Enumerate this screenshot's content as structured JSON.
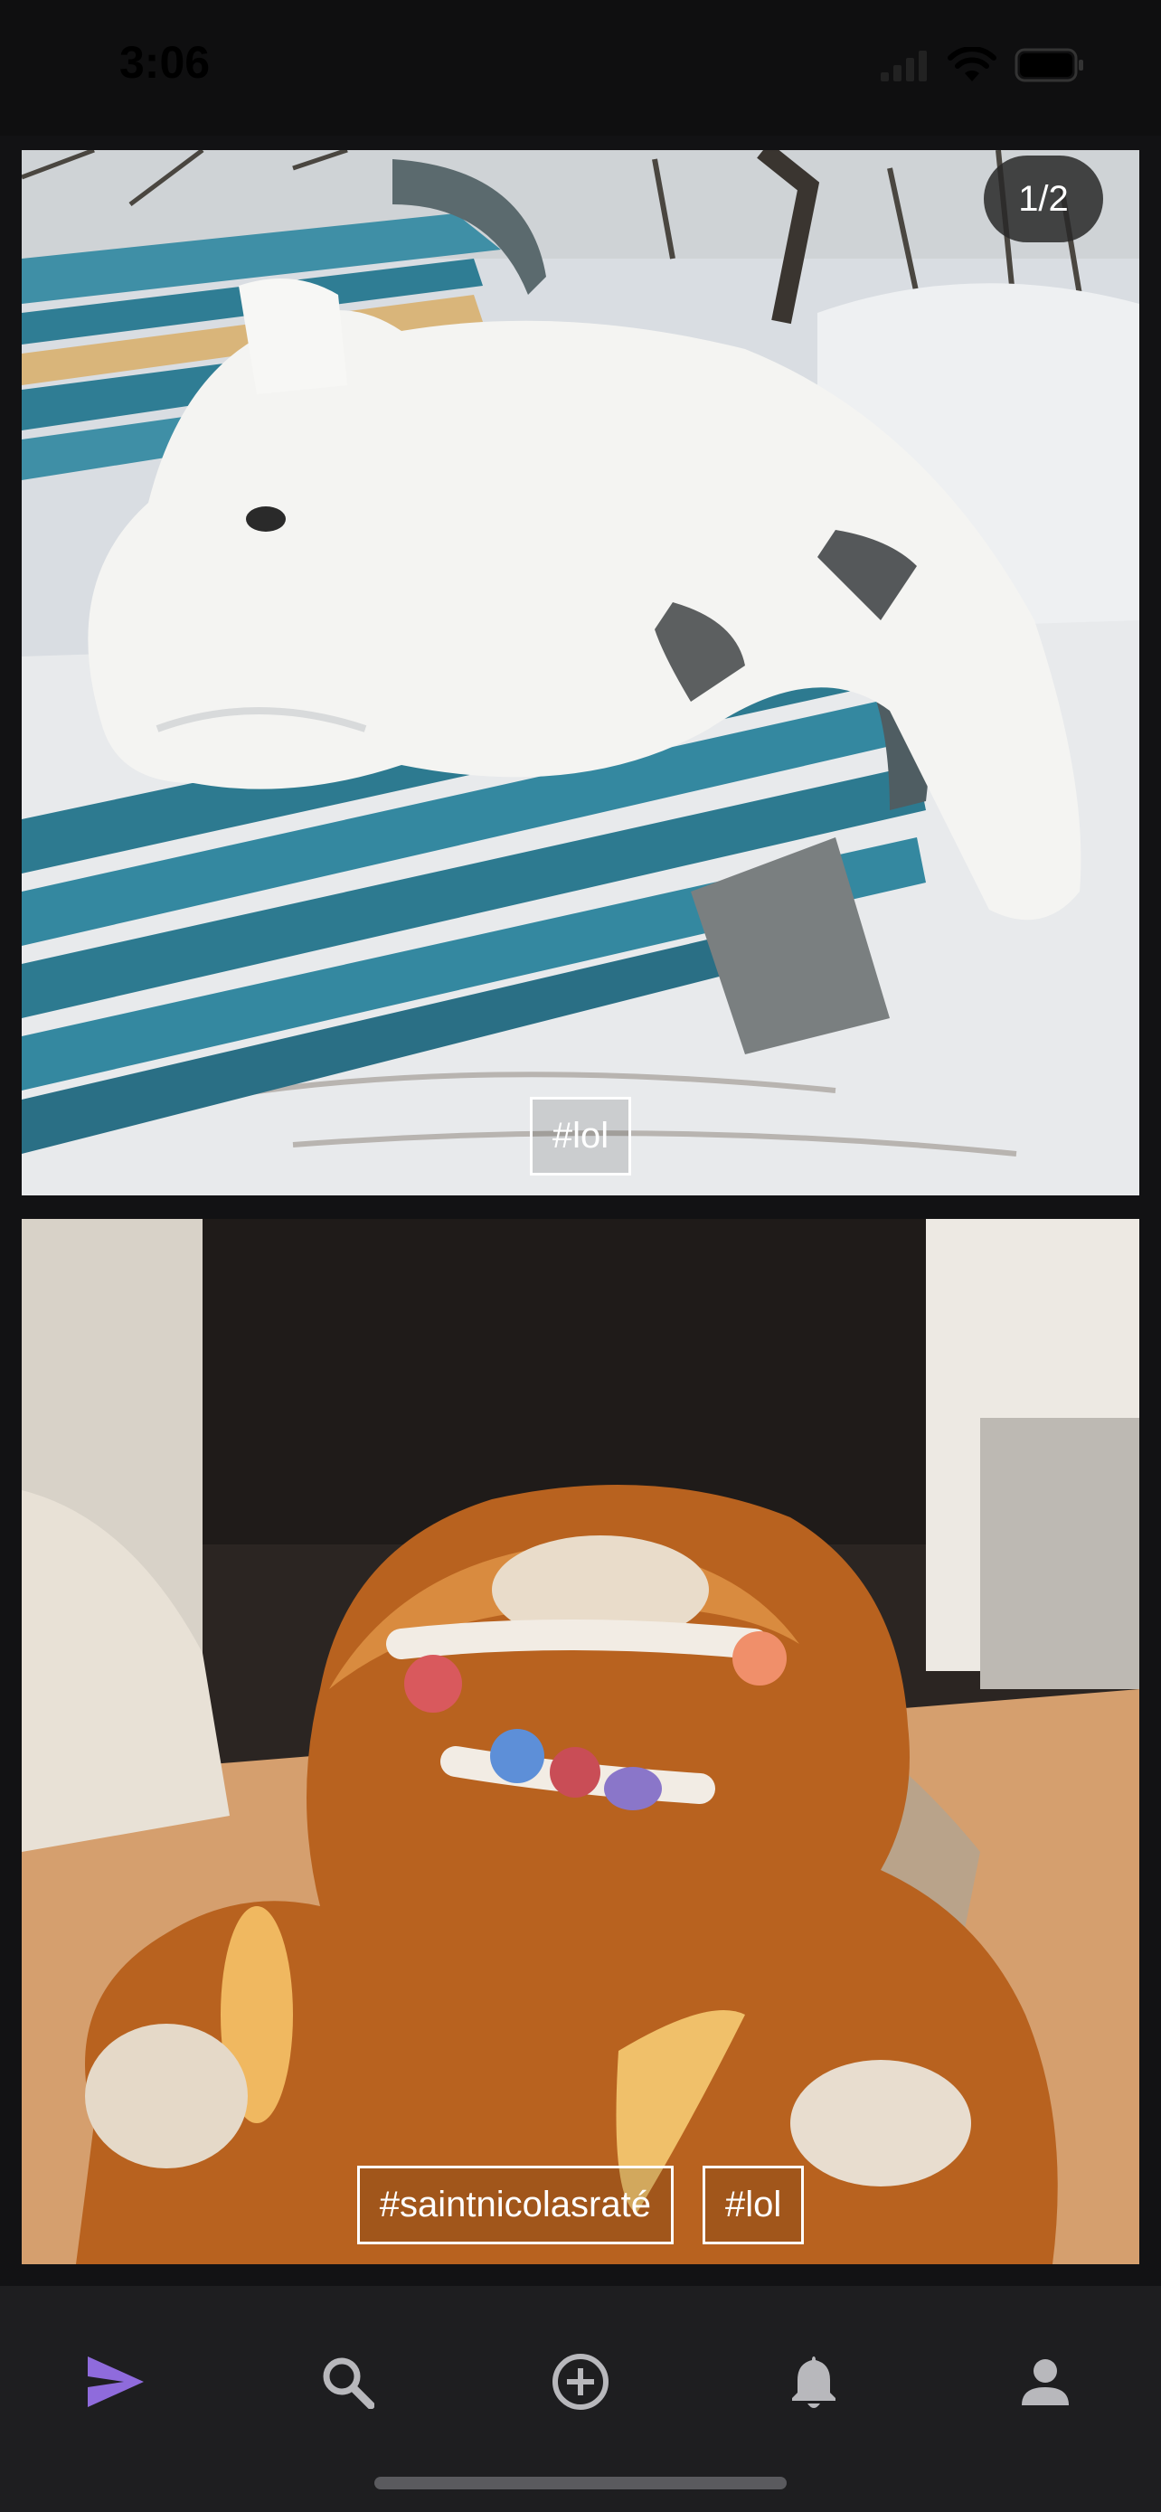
{
  "status_bar": {
    "time": "3:06"
  },
  "feed": {
    "posts": [
      {
        "counter": "1/2",
        "tags": [
          "#lol"
        ]
      },
      {
        "tags": [
          "#saintnicolasraté",
          "#lol"
        ]
      }
    ]
  },
  "tab_bar": {
    "accent_color": "#8f6bdc",
    "items": [
      {
        "icon": "send-icon",
        "active": true
      },
      {
        "icon": "search-icon",
        "active": false
      },
      {
        "icon": "add-circle-icon",
        "active": false
      },
      {
        "icon": "bell-icon",
        "active": false
      },
      {
        "icon": "person-icon",
        "active": false
      }
    ]
  }
}
